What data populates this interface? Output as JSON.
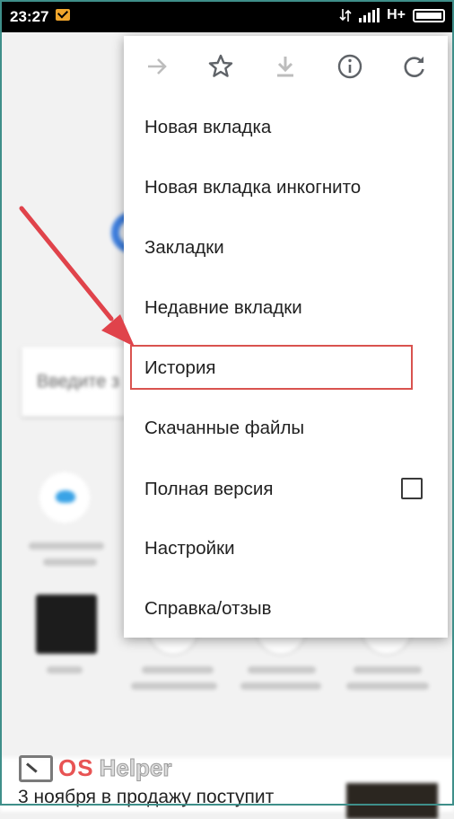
{
  "status_bar": {
    "time": "23:27",
    "network": "H+",
    "icons": [
      "mail-notification-icon",
      "data-transfer-icon",
      "signal-icon",
      "battery-icon"
    ]
  },
  "background": {
    "search_placeholder": "Введите з",
    "news_headline": "3 ноября в продажу поступит"
  },
  "watermark": {
    "os": "OS",
    "helper": "Helper"
  },
  "menu": {
    "toolbar_icons": [
      "forward-arrow-icon",
      "star-icon",
      "download-icon",
      "info-icon",
      "reload-icon"
    ],
    "items": [
      {
        "label": "Новая вкладка"
      },
      {
        "label": "Новая вкладка инкогнито"
      },
      {
        "label": "Закладки"
      },
      {
        "label": "Недавние вкладки"
      },
      {
        "label": "История"
      },
      {
        "label": "Скачанные файлы"
      },
      {
        "label": "Полная версия",
        "checkbox": false
      },
      {
        "label": "Настройки"
      },
      {
        "label": "Справка/отзыв"
      }
    ],
    "highlighted_item": "История",
    "colors": {
      "highlight": "#d9534f",
      "icon": "#5f6368",
      "disabled_icon": "#bdbdbd"
    }
  }
}
